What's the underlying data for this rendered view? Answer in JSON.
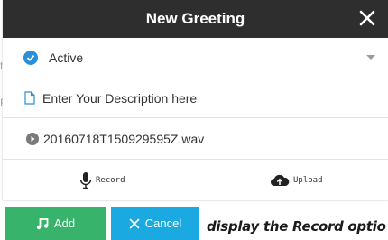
{
  "dialog": {
    "title": "New Greeting",
    "close_label": "✕",
    "status": {
      "label": "Active"
    },
    "description": {
      "placeholder": "Enter Your Description here",
      "value": ""
    },
    "file": {
      "name": "20160718T150929595Z.wav"
    },
    "actions": {
      "record_label": "Record",
      "upload_label": "Upload"
    }
  },
  "buttons": {
    "add_label": "Add",
    "cancel_label": "Cancel"
  },
  "caption": "display the Record optio",
  "colors": {
    "titlebar": "#2e2e2e",
    "check": "#2a8fd8",
    "add": "#38b36b",
    "cancel": "#1aa9e0"
  },
  "icons": {
    "close": "close-icon",
    "status": "check-circle-icon",
    "dropdown": "chevron-down-icon",
    "description": "file-icon",
    "play": "play-icon",
    "record": "microphone-icon",
    "upload": "cloud-upload-icon",
    "add": "music-note-icon",
    "cancel": "close-icon"
  }
}
